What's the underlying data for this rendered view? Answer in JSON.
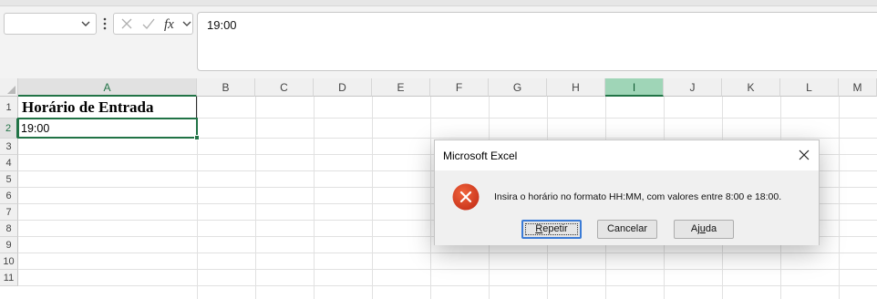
{
  "formula_bar": {
    "name_box_value": "",
    "formula_value": "19:00",
    "icons": [
      "chevron-down-icon",
      "more-vertical-icon",
      "cancel-icon",
      "confirm-icon",
      "insert-function-icon"
    ]
  },
  "sheet": {
    "columns": [
      "A",
      "B",
      "C",
      "D",
      "E",
      "F",
      "G",
      "H",
      "I",
      "J",
      "K",
      "L",
      "M"
    ],
    "rows": [
      "1",
      "2",
      "3",
      "4",
      "5",
      "6",
      "7",
      "8",
      "9",
      "10",
      "11"
    ],
    "cells": {
      "A1": "Horário de Entrada",
      "A2": "19:00"
    },
    "active_cell": "A2",
    "highlighted_column": "I",
    "accent_color": "#217346"
  },
  "dialog": {
    "title": "Microsoft Excel",
    "message": "Insira o horário no formato HH:MM, com valores entre 8:00 e 18:00.",
    "icon": "error-icon",
    "buttons": {
      "retry_accel": "R",
      "retry_rest": "epetir",
      "cancel": "Cancelar",
      "help_pre": "Aj",
      "help_accel": "u",
      "help_post": "da"
    }
  }
}
